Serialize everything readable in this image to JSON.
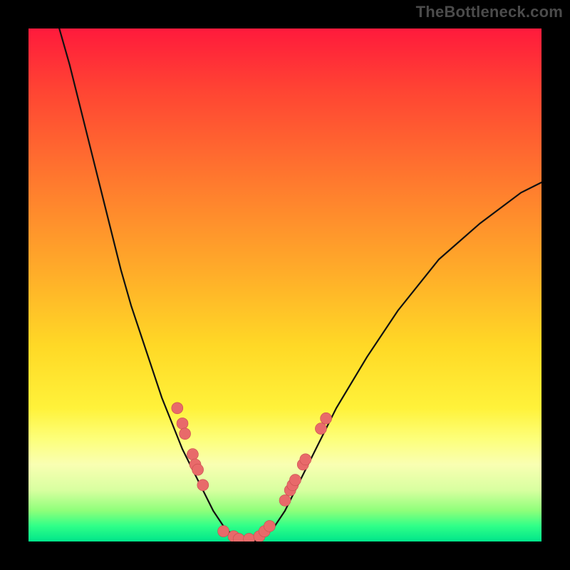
{
  "watermark": "TheBottleneck.com",
  "chart_data": {
    "type": "line",
    "title": "",
    "xlabel": "",
    "ylabel": "",
    "xlim": [
      0,
      100
    ],
    "ylim": [
      0,
      100
    ],
    "grid": false,
    "legend": false,
    "curve": {
      "description": "V-shaped bottleneck curve: high on left edge, dips to zero near x≈40, rises to right",
      "x": [
        6,
        8,
        10,
        12,
        14,
        16,
        18,
        20,
        22,
        24,
        26,
        28,
        30,
        32,
        34,
        36,
        38,
        40,
        42,
        44,
        46,
        48,
        50,
        52,
        56,
        60,
        66,
        72,
        80,
        88,
        96,
        100
      ],
      "y": [
        100,
        93,
        85,
        77,
        69,
        61,
        53,
        46,
        40,
        34,
        28,
        23,
        18,
        14,
        10,
        6,
        3,
        1,
        0,
        0,
        1,
        3,
        6,
        10,
        18,
        26,
        36,
        45,
        55,
        62,
        68,
        70
      ]
    },
    "markers": {
      "description": "Highlighted data points (pink dots) clustered near the lower V region",
      "points": [
        {
          "x": 29,
          "y": 26
        },
        {
          "x": 30,
          "y": 23
        },
        {
          "x": 30.5,
          "y": 21
        },
        {
          "x": 32,
          "y": 17
        },
        {
          "x": 32.5,
          "y": 15
        },
        {
          "x": 33,
          "y": 14
        },
        {
          "x": 34,
          "y": 11
        },
        {
          "x": 38,
          "y": 2
        },
        {
          "x": 40,
          "y": 1
        },
        {
          "x": 41,
          "y": 0.5
        },
        {
          "x": 43,
          "y": 0.5
        },
        {
          "x": 45,
          "y": 1
        },
        {
          "x": 46,
          "y": 2
        },
        {
          "x": 47,
          "y": 3
        },
        {
          "x": 50,
          "y": 8
        },
        {
          "x": 51,
          "y": 10
        },
        {
          "x": 51.5,
          "y": 11
        },
        {
          "x": 52,
          "y": 12
        },
        {
          "x": 53.5,
          "y": 15
        },
        {
          "x": 54,
          "y": 16
        },
        {
          "x": 57,
          "y": 22
        },
        {
          "x": 58,
          "y": 24
        }
      ]
    },
    "background_gradient": {
      "top": "#ff1a3c",
      "mid_upper": "#ff7a2e",
      "mid": "#ffd926",
      "mid_lower": "#fdff7a",
      "bottom": "#00e58a"
    }
  }
}
